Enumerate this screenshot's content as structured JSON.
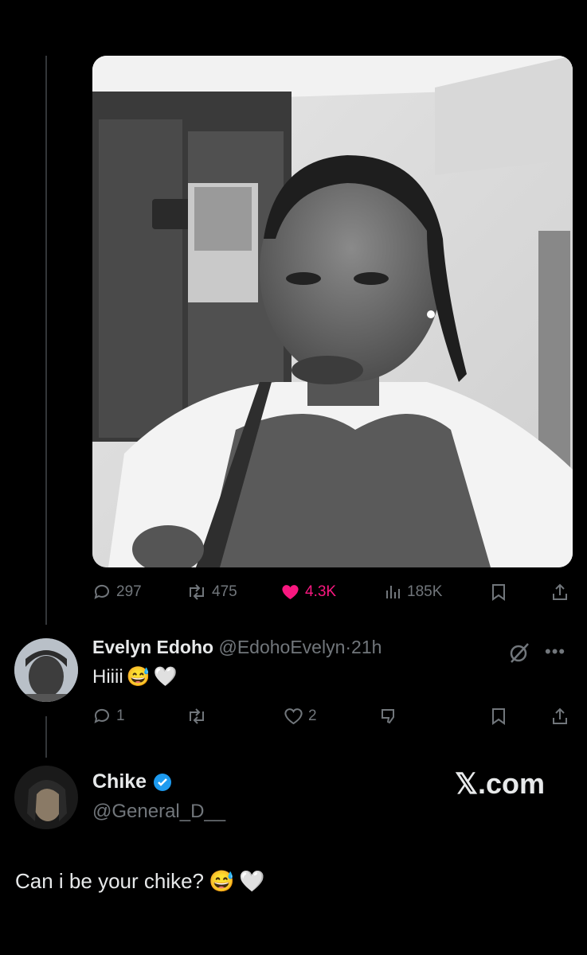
{
  "main_post": {
    "media_alt": "photo",
    "stats": {
      "replies": "297",
      "reposts": "475",
      "likes": "4.3K",
      "views": "185K"
    }
  },
  "reply": {
    "display_name": "Evelyn Edoho",
    "handle": "@EdohoEvelyn",
    "separator": "·",
    "time": "21h",
    "text": "Hiiii",
    "emojis": [
      "😅",
      "🤍"
    ],
    "stats": {
      "replies": "1",
      "likes": "2"
    }
  },
  "quote": {
    "display_name": "Chike",
    "handle": "@General_D__",
    "verified": true,
    "text": "Can i be your chike?",
    "emojis": [
      "😅",
      "🤍"
    ]
  },
  "brand": "𝕏.com",
  "colors": {
    "background": "#000000",
    "text": "#e7e9ea",
    "muted": "#71767b",
    "like": "#f91880",
    "verified": "#1d9bf0"
  },
  "icons": [
    "reply-icon",
    "repost-icon",
    "like-icon",
    "views-icon",
    "bookmark-icon",
    "share-icon",
    "grok-icon",
    "more-icon",
    "verified-badge-icon",
    "downvote-icon"
  ]
}
